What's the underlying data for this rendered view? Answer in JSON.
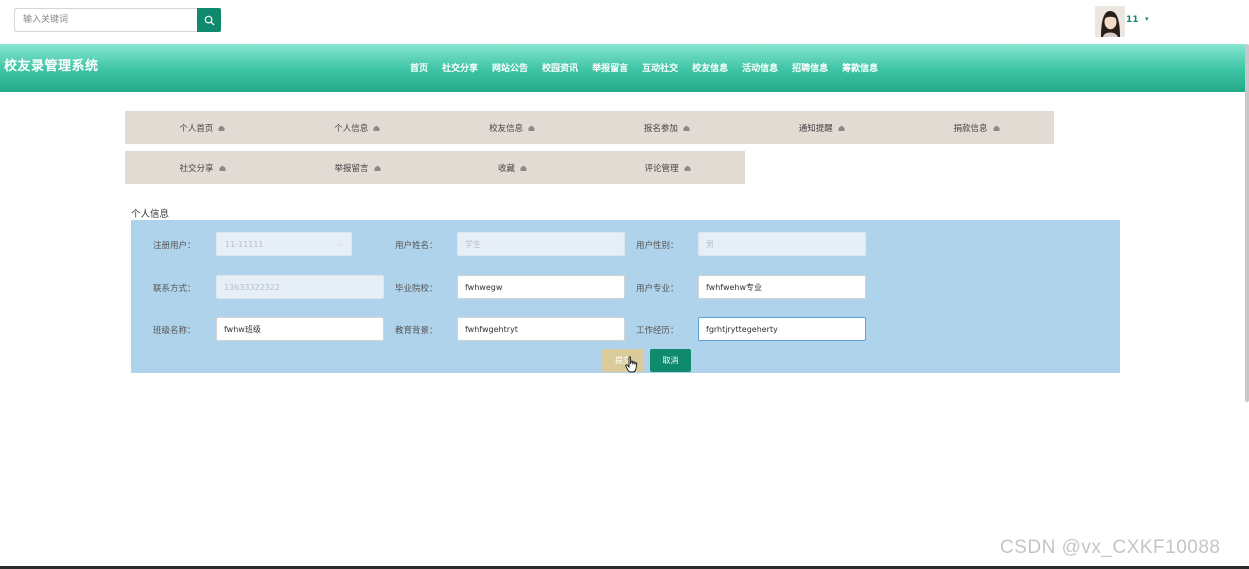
{
  "search": {
    "placeholder": "输入关键词",
    "icon": "search-icon"
  },
  "user": {
    "name": "11",
    "caret": "▾"
  },
  "brand": {
    "title": "校友录管理系统"
  },
  "nav": [
    "首页",
    "社交分享",
    "网站公告",
    "校园资讯",
    "举报留言",
    "互动社交",
    "校友信息",
    "活动信息",
    "招聘信息",
    "筹款信息"
  ],
  "menu_row1": [
    "个人首页",
    "个人信息",
    "校友信息",
    "报名参加",
    "通知提醒",
    "捐款信息"
  ],
  "menu_row2": [
    "社交分享",
    "举报留言",
    "收藏",
    "评论管理"
  ],
  "section": {
    "title": "个人信息"
  },
  "form": {
    "reg_user": {
      "label": "注册用户：",
      "value": "11-11111"
    },
    "user_name": {
      "label": "用户姓名：",
      "value": "学生"
    },
    "gender": {
      "label": "用户性别：",
      "value": "男"
    },
    "phone": {
      "label": "联系方式：",
      "value": "13633322322"
    },
    "school": {
      "label": "毕业院校：",
      "value": "fwhwegw"
    },
    "major": {
      "label": "用户专业：",
      "value": "fwhfwehw专业"
    },
    "class_name": {
      "label": "班级名称：",
      "value": "fwhw班级"
    },
    "education": {
      "label": "教育背景：",
      "value": "fwhfwgehtryt"
    },
    "work": {
      "label": "工作经历：",
      "value": "fgrhtjryttegeherty"
    }
  },
  "buttons": {
    "submit": "提交",
    "cancel": "取消"
  },
  "watermark": "CSDN @vx_CXKF10088",
  "colors": {
    "accent": "#0f8a6c",
    "nav_gradient_top": "#86e6d1",
    "nav_gradient_bottom": "#23a987",
    "panel": "#aed3ea",
    "menu_bg": "#e2dbd4",
    "submit": "#dccb9a"
  }
}
